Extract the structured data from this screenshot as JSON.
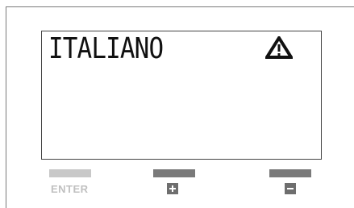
{
  "display": {
    "language": "ITALIANO",
    "status_icon": "warning-triangle-icon"
  },
  "buttons": {
    "enter_label": "ENTER",
    "plus_icon": "plus-icon",
    "minus_icon": "minus-icon"
  },
  "colors": {
    "enter_disabled": "#c8c8c8",
    "button_active": "#7a7a7a",
    "lcd_text": "#111111"
  }
}
